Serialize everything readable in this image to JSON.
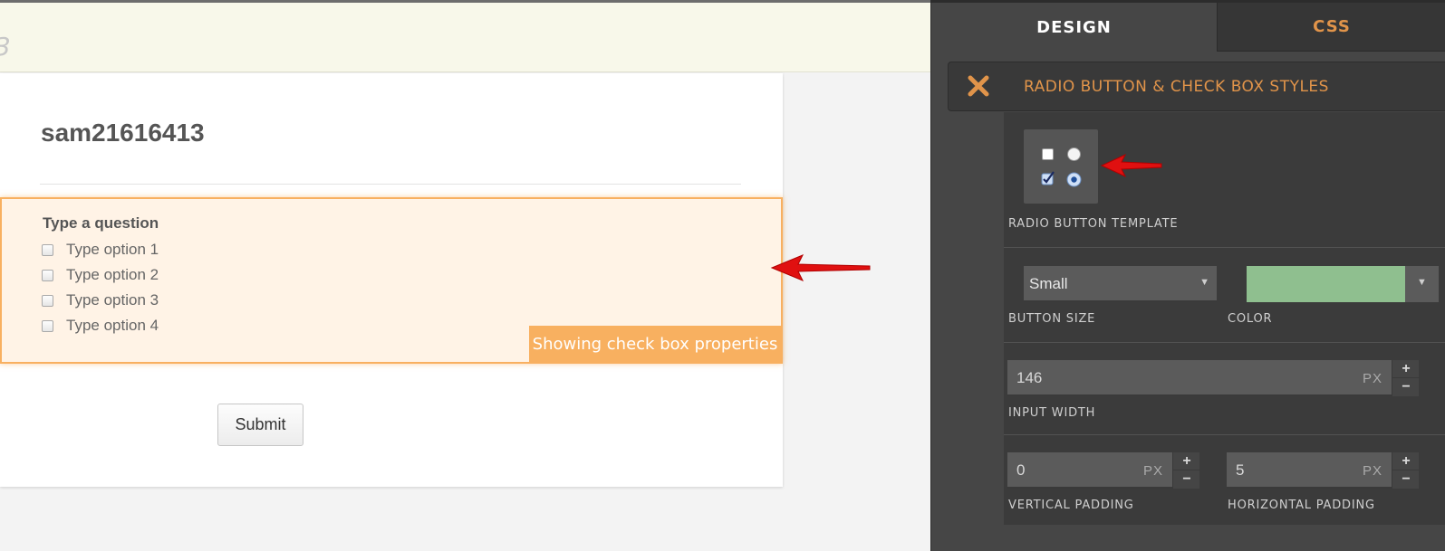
{
  "canvas": {
    "topbar_ghost_text": "3",
    "form_title": "sam21616413",
    "question": {
      "label": "Type a question",
      "options": [
        "Type option 1",
        "Type option 2",
        "Type option 3",
        "Type option 4"
      ]
    },
    "props_badge": "Showing check box properties",
    "submit_label": "Submit"
  },
  "panel": {
    "tabs": [
      {
        "label": "DESIGN",
        "active": true
      },
      {
        "label": "CSS",
        "active": false
      }
    ],
    "section": {
      "close_icon": "close-x-icon",
      "title": "RADIO BUTTON & CHECK BOX STYLES"
    },
    "fields": {
      "template_label": "RADIO BUTTON TEMPLATE",
      "button_size": {
        "label": "BUTTON SIZE",
        "value": "Small"
      },
      "color": {
        "label": "COLOR",
        "value": "#8fbf8f"
      },
      "input_width": {
        "label": "INPUT WIDTH",
        "value": "146",
        "unit": "PX"
      },
      "vertical_padding": {
        "label": "VERTICAL PADDING",
        "value": "0",
        "unit": "PX"
      },
      "horizontal_padding": {
        "label": "HORIZONTAL PADDING",
        "value": "5",
        "unit": "PX"
      }
    }
  },
  "colors": {
    "accent_orange": "#e1944a",
    "highlight_orange": "#f8b060",
    "annotation_red": "#e01010"
  }
}
